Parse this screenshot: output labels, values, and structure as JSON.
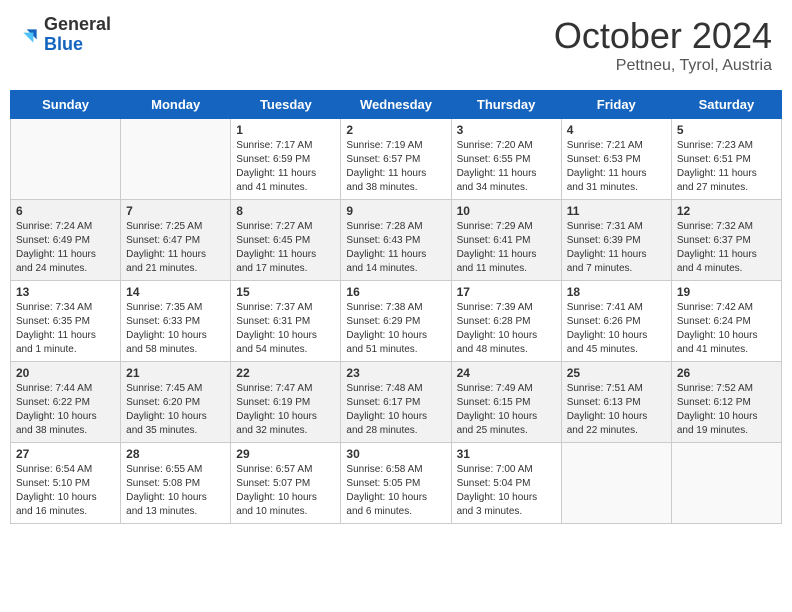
{
  "header": {
    "logo_general": "General",
    "logo_blue": "Blue",
    "month_title": "October 2024",
    "subtitle": "Pettneu, Tyrol, Austria"
  },
  "days_of_week": [
    "Sunday",
    "Monday",
    "Tuesday",
    "Wednesday",
    "Thursday",
    "Friday",
    "Saturday"
  ],
  "weeks": [
    [
      {
        "day": "",
        "info": ""
      },
      {
        "day": "",
        "info": ""
      },
      {
        "day": "1",
        "info": "Sunrise: 7:17 AM\nSunset: 6:59 PM\nDaylight: 11 hours and 41 minutes."
      },
      {
        "day": "2",
        "info": "Sunrise: 7:19 AM\nSunset: 6:57 PM\nDaylight: 11 hours and 38 minutes."
      },
      {
        "day": "3",
        "info": "Sunrise: 7:20 AM\nSunset: 6:55 PM\nDaylight: 11 hours and 34 minutes."
      },
      {
        "day": "4",
        "info": "Sunrise: 7:21 AM\nSunset: 6:53 PM\nDaylight: 11 hours and 31 minutes."
      },
      {
        "day": "5",
        "info": "Sunrise: 7:23 AM\nSunset: 6:51 PM\nDaylight: 11 hours and 27 minutes."
      }
    ],
    [
      {
        "day": "6",
        "info": "Sunrise: 7:24 AM\nSunset: 6:49 PM\nDaylight: 11 hours and 24 minutes."
      },
      {
        "day": "7",
        "info": "Sunrise: 7:25 AM\nSunset: 6:47 PM\nDaylight: 11 hours and 21 minutes."
      },
      {
        "day": "8",
        "info": "Sunrise: 7:27 AM\nSunset: 6:45 PM\nDaylight: 11 hours and 17 minutes."
      },
      {
        "day": "9",
        "info": "Sunrise: 7:28 AM\nSunset: 6:43 PM\nDaylight: 11 hours and 14 minutes."
      },
      {
        "day": "10",
        "info": "Sunrise: 7:29 AM\nSunset: 6:41 PM\nDaylight: 11 hours and 11 minutes."
      },
      {
        "day": "11",
        "info": "Sunrise: 7:31 AM\nSunset: 6:39 PM\nDaylight: 11 hours and 7 minutes."
      },
      {
        "day": "12",
        "info": "Sunrise: 7:32 AM\nSunset: 6:37 PM\nDaylight: 11 hours and 4 minutes."
      }
    ],
    [
      {
        "day": "13",
        "info": "Sunrise: 7:34 AM\nSunset: 6:35 PM\nDaylight: 11 hours and 1 minute."
      },
      {
        "day": "14",
        "info": "Sunrise: 7:35 AM\nSunset: 6:33 PM\nDaylight: 10 hours and 58 minutes."
      },
      {
        "day": "15",
        "info": "Sunrise: 7:37 AM\nSunset: 6:31 PM\nDaylight: 10 hours and 54 minutes."
      },
      {
        "day": "16",
        "info": "Sunrise: 7:38 AM\nSunset: 6:29 PM\nDaylight: 10 hours and 51 minutes."
      },
      {
        "day": "17",
        "info": "Sunrise: 7:39 AM\nSunset: 6:28 PM\nDaylight: 10 hours and 48 minutes."
      },
      {
        "day": "18",
        "info": "Sunrise: 7:41 AM\nSunset: 6:26 PM\nDaylight: 10 hours and 45 minutes."
      },
      {
        "day": "19",
        "info": "Sunrise: 7:42 AM\nSunset: 6:24 PM\nDaylight: 10 hours and 41 minutes."
      }
    ],
    [
      {
        "day": "20",
        "info": "Sunrise: 7:44 AM\nSunset: 6:22 PM\nDaylight: 10 hours and 38 minutes."
      },
      {
        "day": "21",
        "info": "Sunrise: 7:45 AM\nSunset: 6:20 PM\nDaylight: 10 hours and 35 minutes."
      },
      {
        "day": "22",
        "info": "Sunrise: 7:47 AM\nSunset: 6:19 PM\nDaylight: 10 hours and 32 minutes."
      },
      {
        "day": "23",
        "info": "Sunrise: 7:48 AM\nSunset: 6:17 PM\nDaylight: 10 hours and 28 minutes."
      },
      {
        "day": "24",
        "info": "Sunrise: 7:49 AM\nSunset: 6:15 PM\nDaylight: 10 hours and 25 minutes."
      },
      {
        "day": "25",
        "info": "Sunrise: 7:51 AM\nSunset: 6:13 PM\nDaylight: 10 hours and 22 minutes."
      },
      {
        "day": "26",
        "info": "Sunrise: 7:52 AM\nSunset: 6:12 PM\nDaylight: 10 hours and 19 minutes."
      }
    ],
    [
      {
        "day": "27",
        "info": "Sunrise: 6:54 AM\nSunset: 5:10 PM\nDaylight: 10 hours and 16 minutes."
      },
      {
        "day": "28",
        "info": "Sunrise: 6:55 AM\nSunset: 5:08 PM\nDaylight: 10 hours and 13 minutes."
      },
      {
        "day": "29",
        "info": "Sunrise: 6:57 AM\nSunset: 5:07 PM\nDaylight: 10 hours and 10 minutes."
      },
      {
        "day": "30",
        "info": "Sunrise: 6:58 AM\nSunset: 5:05 PM\nDaylight: 10 hours and 6 minutes."
      },
      {
        "day": "31",
        "info": "Sunrise: 7:00 AM\nSunset: 5:04 PM\nDaylight: 10 hours and 3 minutes."
      },
      {
        "day": "",
        "info": ""
      },
      {
        "day": "",
        "info": ""
      }
    ]
  ]
}
